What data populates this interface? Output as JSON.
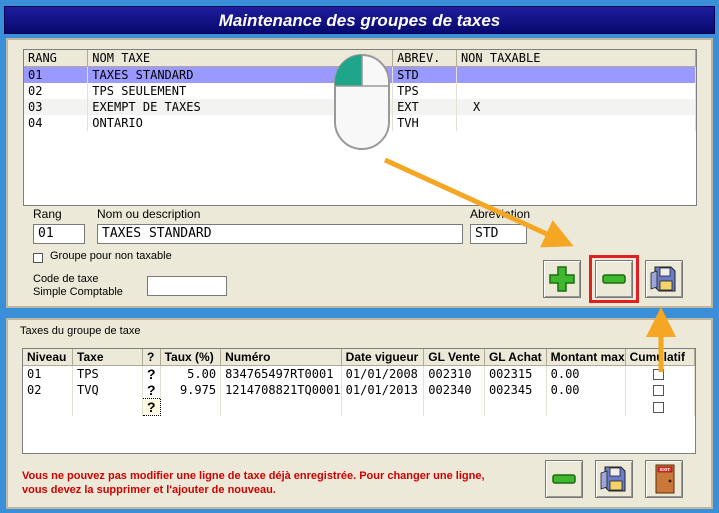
{
  "window": {
    "title": "Maintenance des groupes de taxes"
  },
  "groups_table": {
    "headers": [
      "RANG",
      "NOM TAXE",
      "ABREV.",
      "NON TAXABLE"
    ],
    "rows": [
      [
        "01",
        "TAXES STANDARD",
        "STD",
        ""
      ],
      [
        "02",
        "TPS SEULEMENT",
        "TPS",
        ""
      ],
      [
        "03",
        "EXEMPT DE TAXES",
        "EXT",
        "X"
      ],
      [
        "04",
        "ONTARIO",
        "TVH",
        ""
      ]
    ]
  },
  "form": {
    "rang_label": "Rang",
    "rang_value": "01",
    "nom_label": "Nom ou description",
    "nom_value": "TAXES STANDARD",
    "abrev_label": "Abreviation",
    "abrev_value": "STD",
    "non_taxable_label": "Groupe pour non taxable",
    "code_label_1": "Code de taxe",
    "code_label_2": "Simple Comptable",
    "code_value": ""
  },
  "taxes_section": {
    "title": "Taxes du groupe de taxe",
    "headers": [
      "Niveau",
      "Taxe",
      "?",
      "Taux (%)",
      "Numéro",
      "Date vigueur",
      "GL Vente",
      "GL Achat",
      "Montant max",
      "Cumulatif"
    ],
    "rows": [
      [
        "01",
        "TPS",
        "?",
        "5.00",
        "834765497RT0001",
        "01/01/2008",
        "002310",
        "002315",
        "0.00"
      ],
      [
        "02",
        "TVQ",
        "?",
        "9.975",
        "1214708821TQ0001",
        "01/01/2013",
        "002340",
        "002345",
        "0.00"
      ],
      [
        "",
        "",
        "?",
        "",
        "",
        "",
        "",
        "",
        ""
      ]
    ]
  },
  "message": {
    "line1": "Vous ne pouvez pas modifier une ligne de taxe déjà enregistrée. Pour changer une ligne,",
    "line2": "vous devez la supprimer et l'ajouter de nouveau."
  },
  "colors": {
    "title_bar": "#0a0a80",
    "background": "#3b8fd8",
    "selected_row": "#9999ff",
    "highlight_box": "#e02020",
    "arrow": "#f5a623",
    "message": "#d00000"
  },
  "icons": [
    "add-icon",
    "remove-icon",
    "save-icon",
    "exit-door-icon",
    "mouse-cursor-icon",
    "annotation-arrow"
  ]
}
